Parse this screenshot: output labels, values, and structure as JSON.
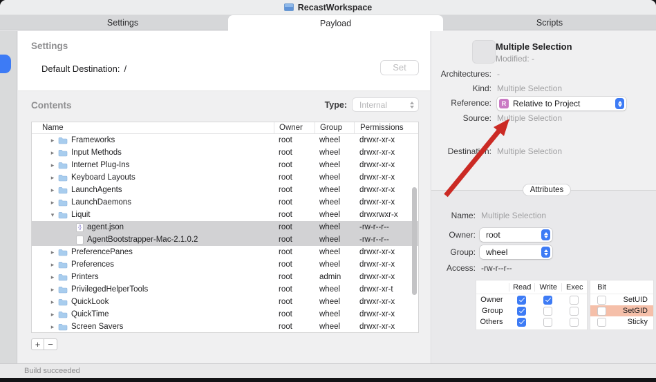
{
  "window": {
    "title": "RecastWorkspace"
  },
  "tabs": [
    {
      "label": "Settings",
      "active": false
    },
    {
      "label": "Payload",
      "active": true
    },
    {
      "label": "Scripts",
      "active": false
    }
  ],
  "settings": {
    "heading": "Settings",
    "default_destination_label": "Default Destination:",
    "default_destination_value": "/",
    "set_button": "Set"
  },
  "contents": {
    "heading": "Contents",
    "type_label": "Type:",
    "type_value": "Internal",
    "columns": [
      "Name",
      "Owner",
      "Group",
      "Permissions"
    ],
    "rows": [
      {
        "name": "Frameworks",
        "owner": "root",
        "group": "wheel",
        "permissions": "drwxr-xr-x",
        "indent": 1,
        "chevron": "right",
        "icon": "folder",
        "selected": false
      },
      {
        "name": "Input Methods",
        "owner": "root",
        "group": "wheel",
        "permissions": "drwxr-xr-x",
        "indent": 1,
        "chevron": "right",
        "icon": "folder",
        "selected": false
      },
      {
        "name": "Internet Plug-Ins",
        "owner": "root",
        "group": "wheel",
        "permissions": "drwxr-xr-x",
        "indent": 1,
        "chevron": "right",
        "icon": "folder",
        "selected": false
      },
      {
        "name": "Keyboard Layouts",
        "owner": "root",
        "group": "wheel",
        "permissions": "drwxr-xr-x",
        "indent": 1,
        "chevron": "right",
        "icon": "folder",
        "selected": false
      },
      {
        "name": "LaunchAgents",
        "owner": "root",
        "group": "wheel",
        "permissions": "drwxr-xr-x",
        "indent": 1,
        "chevron": "right",
        "icon": "folder",
        "selected": false
      },
      {
        "name": "LaunchDaemons",
        "owner": "root",
        "group": "wheel",
        "permissions": "drwxr-xr-x",
        "indent": 1,
        "chevron": "right",
        "icon": "folder",
        "selected": false
      },
      {
        "name": "Liquit",
        "owner": "root",
        "group": "wheel",
        "permissions": "drwxrwxr-x",
        "indent": 1,
        "chevron": "down",
        "icon": "folder",
        "selected": false
      },
      {
        "name": "agent.json",
        "owner": "root",
        "group": "wheel",
        "permissions": "-rw-r--r--",
        "indent": 2,
        "chevron": null,
        "icon": "json",
        "selected": true
      },
      {
        "name": "AgentBootstrapper-Mac-2.1.0.2",
        "owner": "root",
        "group": "wheel",
        "permissions": "-rw-r--r--",
        "indent": 2,
        "chevron": null,
        "icon": "file",
        "selected": true
      },
      {
        "name": "PreferencePanes",
        "owner": "root",
        "group": "wheel",
        "permissions": "drwxr-xr-x",
        "indent": 1,
        "chevron": "right",
        "icon": "folder",
        "selected": false
      },
      {
        "name": "Preferences",
        "owner": "root",
        "group": "wheel",
        "permissions": "drwxr-xr-x",
        "indent": 1,
        "chevron": "right",
        "icon": "folder",
        "selected": false
      },
      {
        "name": "Printers",
        "owner": "root",
        "group": "admin",
        "permissions": "drwxr-xr-x",
        "indent": 1,
        "chevron": "right",
        "icon": "folder",
        "selected": false
      },
      {
        "name": "PrivilegedHelperTools",
        "owner": "root",
        "group": "wheel",
        "permissions": "drwxr-xr-t",
        "indent": 1,
        "chevron": "right",
        "icon": "folder",
        "selected": false
      },
      {
        "name": "QuickLook",
        "owner": "root",
        "group": "wheel",
        "permissions": "drwxr-xr-x",
        "indent": 1,
        "chevron": "right",
        "icon": "folder",
        "selected": false
      },
      {
        "name": "QuickTime",
        "owner": "root",
        "group": "wheel",
        "permissions": "drwxr-xr-x",
        "indent": 1,
        "chevron": "right",
        "icon": "folder",
        "selected": false
      },
      {
        "name": "Screen Savers",
        "owner": "root",
        "group": "wheel",
        "permissions": "drwxr-xr-x",
        "indent": 1,
        "chevron": "right",
        "icon": "folder",
        "selected": false
      }
    ],
    "add_button": "+",
    "remove_button": "−"
  },
  "inspector": {
    "title": "Multiple Selection",
    "modified_label": "Modified:",
    "modified_value": "-",
    "architectures_label": "Architectures:",
    "architectures_value": "-",
    "kind_label": "Kind:",
    "kind_value": "Multiple Selection",
    "reference_label": "Reference:",
    "reference_badge": "R",
    "reference_value": "Relative to Project",
    "source_label": "Source:",
    "source_value": "Multiple Selection",
    "destination_label": "Destination:",
    "destination_value": "Multiple Selection",
    "attributes_tab": "Attributes",
    "name_label": "Name:",
    "name_value": "Multiple Selection",
    "owner_label": "Owner:",
    "owner_value": "root",
    "group_label": "Group:",
    "group_value": "wheel",
    "access_label": "Access:",
    "access_value": "-rw-r--r--",
    "permissions_grid": {
      "columns": [
        "Read",
        "Write",
        "Exec"
      ],
      "bit_column": "Bit",
      "rows": [
        {
          "label": "Owner",
          "read": true,
          "write": true,
          "exec": false,
          "bit": false,
          "bit_label": "SetUID",
          "highlight": false
        },
        {
          "label": "Group",
          "read": true,
          "write": false,
          "exec": false,
          "bit": false,
          "bit_label": "SetGID",
          "highlight": true
        },
        {
          "label": "Others",
          "read": true,
          "write": false,
          "exec": false,
          "bit": false,
          "bit_label": "Sticky",
          "highlight": false
        }
      ]
    }
  },
  "status_bar": {
    "text": "Build succeeded"
  },
  "colors": {
    "accent_blue": "#3d7bf5",
    "badge_pink": "#ca7ac4",
    "highlight_salmon": "#f5bfa9",
    "arrow_red": "#cb2a24",
    "selection_grey": "#d2d2d4",
    "folder_blue": "#a8cdee"
  }
}
